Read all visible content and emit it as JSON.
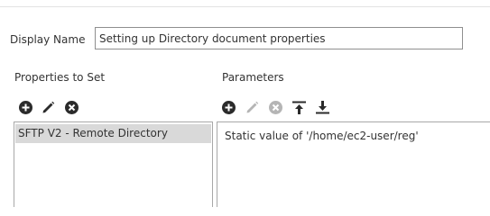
{
  "form": {
    "display_name_label": "Display Name",
    "display_name_value": "Setting up Directory document properties"
  },
  "properties": {
    "header": "Properties to Set",
    "toolbar": [
      {
        "icon": "add-circle-icon",
        "enabled": true
      },
      {
        "icon": "pencil-icon",
        "enabled": true
      },
      {
        "icon": "remove-circle-icon",
        "enabled": true
      }
    ],
    "items": [
      {
        "label": "SFTP V2 - Remote Directory",
        "selected": true
      }
    ]
  },
  "parameters": {
    "header": "Parameters",
    "toolbar": [
      {
        "icon": "add-circle-icon",
        "enabled": true
      },
      {
        "icon": "pencil-icon",
        "enabled": false
      },
      {
        "icon": "remove-circle-icon",
        "enabled": false
      },
      {
        "icon": "move-to-top-icon",
        "enabled": true
      },
      {
        "icon": "move-to-bottom-icon",
        "enabled": true
      }
    ],
    "items": [
      {
        "label": "Static value of '/home/ec2-user/reg'"
      }
    ]
  },
  "colors": {
    "icon_enabled": "#2b2b2b",
    "icon_disabled": "#b5b5b5",
    "selected_row": "#d9d9d9",
    "border": "#a8a8a8"
  }
}
